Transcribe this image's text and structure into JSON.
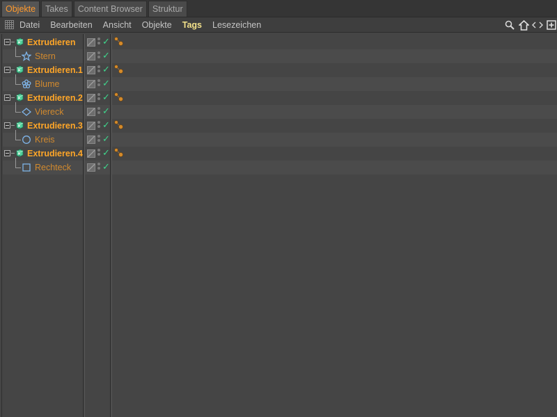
{
  "tabs": [
    {
      "label": "Objekte",
      "active": true
    },
    {
      "label": "Takes",
      "active": false
    },
    {
      "label": "Content Browser",
      "active": false
    },
    {
      "label": "Struktur",
      "active": false
    }
  ],
  "menu": [
    {
      "label": "Datei",
      "highlight": false
    },
    {
      "label": "Bearbeiten",
      "highlight": false
    },
    {
      "label": "Ansicht",
      "highlight": false
    },
    {
      "label": "Objekte",
      "highlight": false
    },
    {
      "label": "Tags",
      "highlight": true
    },
    {
      "label": "Lesezeichen",
      "highlight": false
    }
  ],
  "menu_icons": [
    "search-icon",
    "home-icon",
    "nav-arrows-icon",
    "new-window-icon"
  ],
  "objects": [
    {
      "name": "Extrudieren",
      "kind": "parent",
      "icon": "extrude-icon",
      "has_tag": true
    },
    {
      "name": "Stern",
      "kind": "child",
      "icon": "star-spline-icon",
      "has_tag": false
    },
    {
      "name": "Extrudieren.1",
      "kind": "parent",
      "icon": "extrude-icon",
      "has_tag": true
    },
    {
      "name": "Blume",
      "kind": "child",
      "icon": "flower-spline-icon",
      "has_tag": false
    },
    {
      "name": "Extrudieren.2",
      "kind": "parent",
      "icon": "extrude-icon",
      "has_tag": true
    },
    {
      "name": "Viereck",
      "kind": "child",
      "icon": "diamond-spline-icon",
      "has_tag": false
    },
    {
      "name": "Extrudieren.3",
      "kind": "parent",
      "icon": "extrude-icon",
      "has_tag": true
    },
    {
      "name": "Kreis",
      "kind": "child",
      "icon": "circle-spline-icon",
      "has_tag": false
    },
    {
      "name": "Extrudieren.4",
      "kind": "parent",
      "icon": "extrude-icon",
      "has_tag": true
    },
    {
      "name": "Rechteck",
      "kind": "child",
      "icon": "rectangle-spline-icon",
      "has_tag": false
    }
  ],
  "colors": {
    "active_tab": "#ff9a2e",
    "parent_name": "#ffa628",
    "child_name": "#d28a2e",
    "highlight_menu": "#f2e08a",
    "check": "#3fd68c",
    "spline_icon": "#7fb4e8",
    "extrude_icon": "#4fcf9a",
    "tag": "#d48a2a"
  }
}
